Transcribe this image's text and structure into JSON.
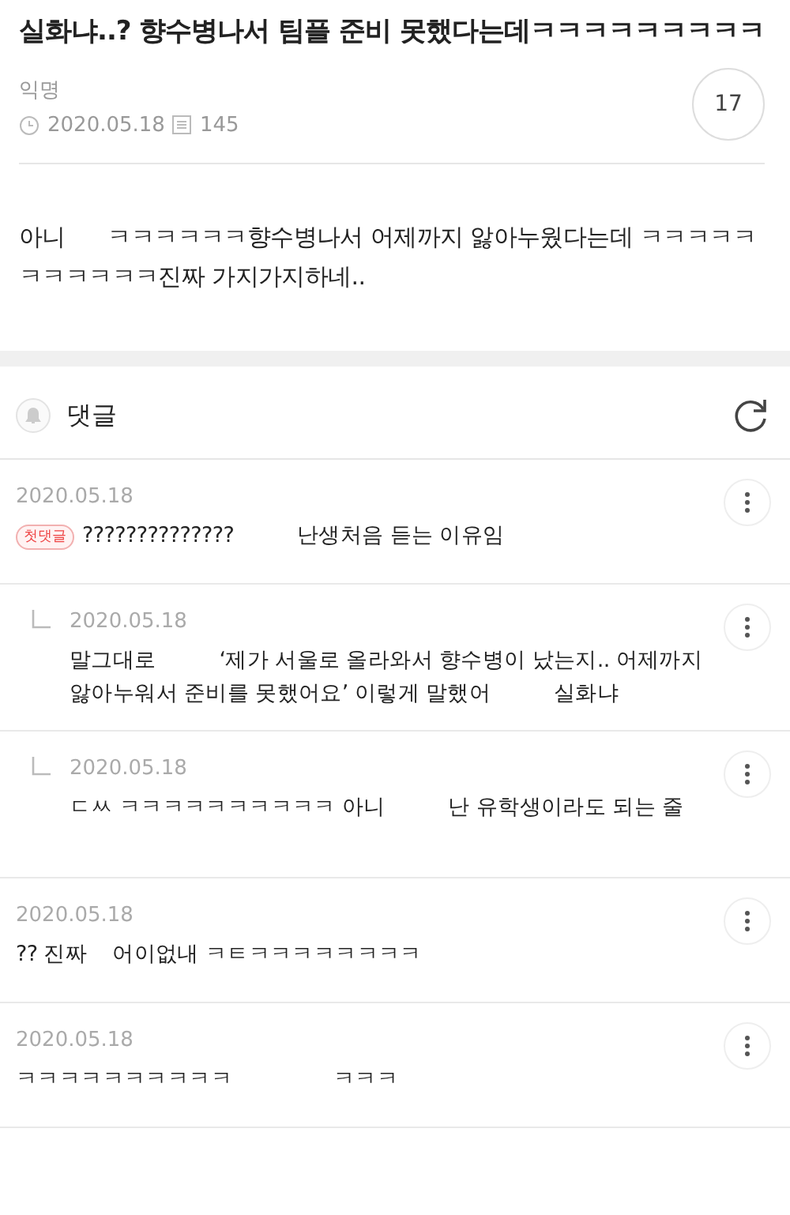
{
  "post": {
    "title": "실화냐..? 향수병나서 팀플 준비 못했다는데ㅋㅋㅋㅋㅋㅋㅋㅋㅋ",
    "author": "익명",
    "date": "2020.05.18",
    "views": "145",
    "comment_count": "17"
  },
  "body": "아니      ㅋㅋㅋㅋㅋㅋ향수병나서 어제까지 앓아누웠다는데 ㅋㅋㅋㅋㅋㅋㅋㅋㅋㅋㅋ진짜 가지가지하네..",
  "comments_header": {
    "label": "댓글"
  },
  "comments": [
    {
      "reply": false,
      "date": "2020.05.18",
      "badge": "첫댓글",
      "text": "??????????????          난생처음 듣는 이유임"
    },
    {
      "reply": true,
      "date": "2020.05.18",
      "text": "말그대로          ‘제가 서울로 올라와서 향수병이 났는지.. 어제까지 앓아누워서 준비를 못했어요’ 이렇게 말했어          실화냐"
    },
    {
      "reply": true,
      "date": "2020.05.18",
      "text": "ㄷㅆ ㅋㅋㅋㅋㅋㅋㅋㅋㅋㅋ 아니          난 유학생이라도 되는 줄"
    },
    {
      "reply": false,
      "date": "2020.05.18",
      "text": "?? 진짜    어이없내 ㅋㅌㅋㅋㅋㅋㅋㅋㅋㅋ"
    },
    {
      "reply": false,
      "date": "2020.05.18",
      "text": "ㅋㅋㅋㅋㅋㅋㅋㅋㅋㅋ                ㅋㅋㅋ"
    }
  ]
}
